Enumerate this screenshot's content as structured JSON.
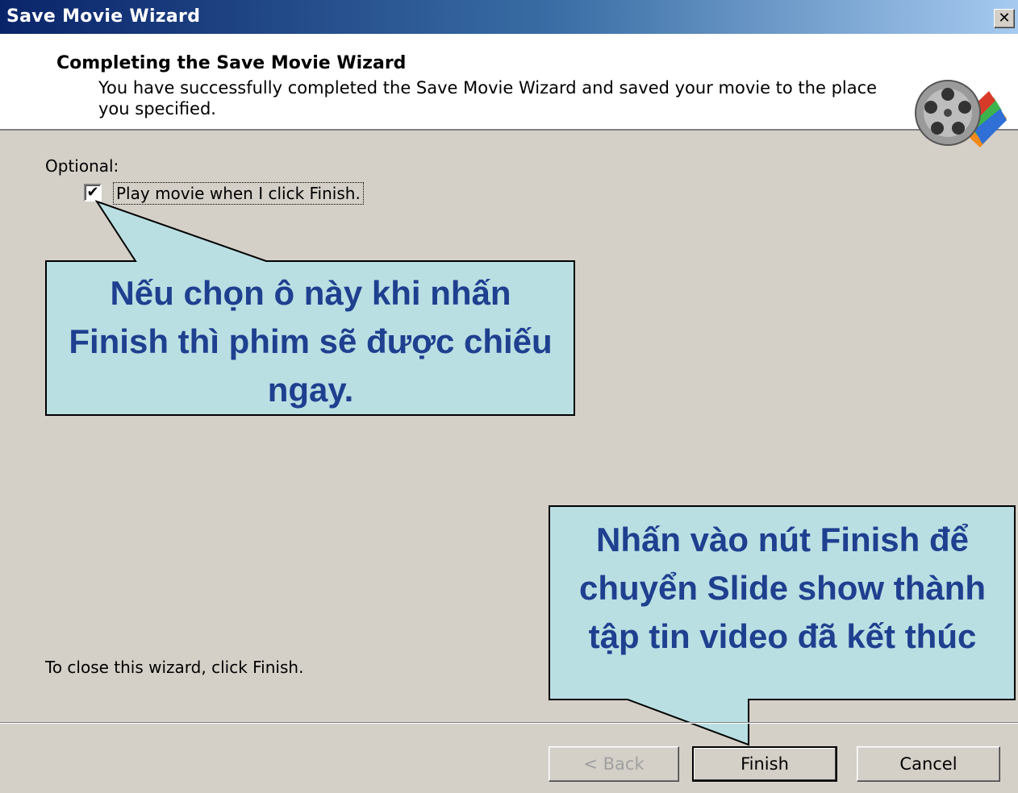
{
  "window": {
    "title": "Save Movie Wizard",
    "close_label": "✕"
  },
  "header": {
    "title": "Completing the Save Movie Wizard",
    "description": "You have successfully completed the Save Movie Wizard and saved your movie to the place you specified.",
    "icon": "movie-reel-icon"
  },
  "body": {
    "optional_label": "Optional:",
    "checkbox": {
      "label": "Play movie when I click Finish.",
      "checked": true
    },
    "close_hint": "To close this wizard, click Finish."
  },
  "callouts": {
    "checkbox_note": "Nếu chọn ô này khi nhấn Finish thì phim sẽ được chiếu ngay.",
    "finish_note": "Nhấn vào nút Finish để chuyển Slide show thành tập tin video đã kết thúc"
  },
  "buttons": {
    "back": "< Back",
    "finish": "Finish",
    "cancel": "Cancel"
  },
  "colors": {
    "callout_fill": "#b9dfe3",
    "callout_text": "#1f3f8f",
    "title_bar": "#0a246a"
  }
}
